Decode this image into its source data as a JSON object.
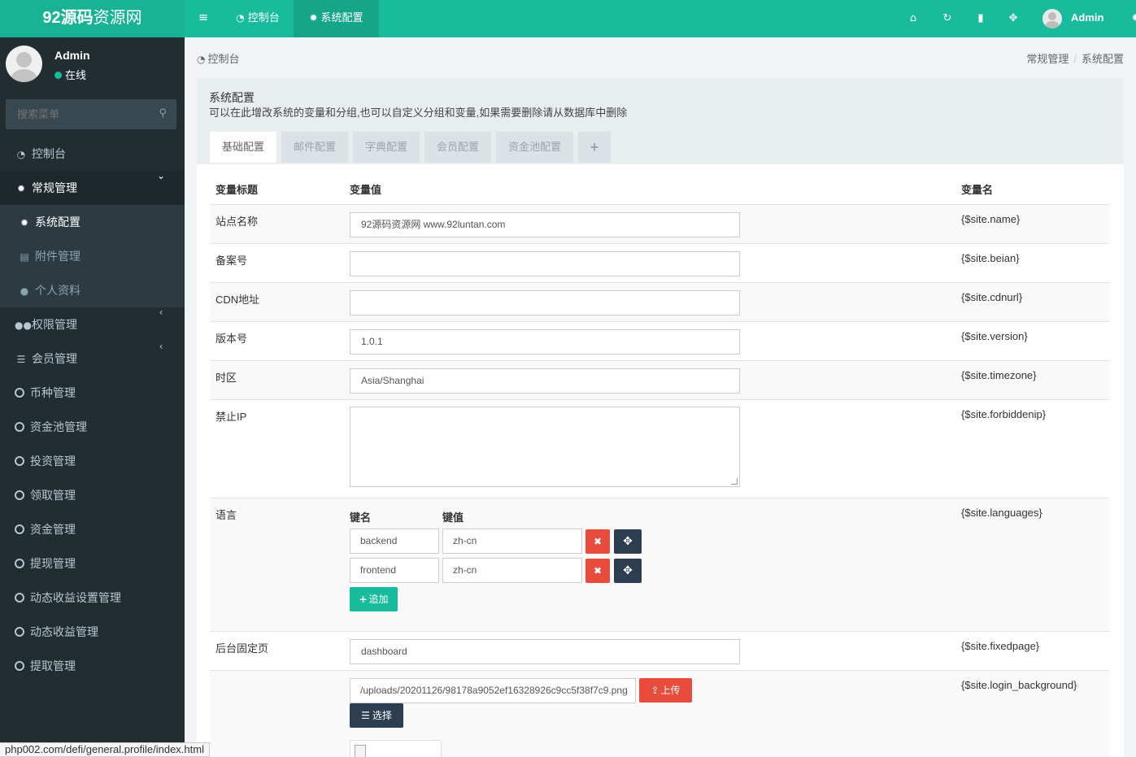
{
  "brand": {
    "bold": "92源码",
    "rest": "资源网"
  },
  "topnav": {
    "tabs": [
      {
        "label": "控制台",
        "icon": "dashboard-icon"
      },
      {
        "label": "系统配置",
        "icon": "gear-icon"
      }
    ],
    "right_icons": [
      "home-icon",
      "refresh-icon",
      "trash-icon",
      "fullscreen-icon"
    ],
    "user": "Admin"
  },
  "sidebar": {
    "user": {
      "name": "Admin",
      "status": "在线"
    },
    "search_placeholder": "搜索菜单",
    "items": [
      {
        "label": "控制台",
        "icon": "dashboard-icon"
      },
      {
        "label": "常规管理",
        "icon": "cogs-icon"
      },
      {
        "label": "系统配置",
        "icon": "gear-icon"
      },
      {
        "label": "附件管理",
        "icon": "file-image-icon"
      },
      {
        "label": "个人资料",
        "icon": "user-icon"
      },
      {
        "label": "权限管理",
        "icon": "group-icon"
      },
      {
        "label": "会员管理",
        "icon": "list-icon"
      },
      {
        "label": "币种管理",
        "icon": "circle-icon"
      },
      {
        "label": "资金池管理",
        "icon": "circle-icon"
      },
      {
        "label": "投资管理",
        "icon": "circle-icon"
      },
      {
        "label": "领取管理",
        "icon": "circle-icon"
      },
      {
        "label": "资金管理",
        "icon": "circle-icon"
      },
      {
        "label": "提现管理",
        "icon": "circle-icon"
      },
      {
        "label": "动态收益设置管理",
        "icon": "circle-icon"
      },
      {
        "label": "动态收益管理",
        "icon": "circle-icon"
      },
      {
        "label": "提取管理",
        "icon": "circle-icon"
      }
    ]
  },
  "breadcrumb": {
    "left": "控制台",
    "right": [
      "常规管理",
      "系统配置"
    ]
  },
  "panel": {
    "title": "系统配置",
    "description": "可以在此增改系统的变量和分组,也可以自定义分组和变量,如果需要删除请从数据库中删除",
    "tabs": [
      "基础配置",
      "邮件配置",
      "字典配置",
      "会员配置",
      "资金池配置",
      "+"
    ]
  },
  "table": {
    "headers": [
      "变量标题",
      "变量值",
      "变量名"
    ],
    "rows": [
      {
        "label": "站点名称",
        "value": "92源码资源网 www.92luntan.com",
        "var": "{$site.name}"
      },
      {
        "label": "备案号",
        "value": "",
        "var": "{$site.beian}"
      },
      {
        "label": "CDN地址",
        "value": "",
        "var": "{$site.cdnurl}"
      },
      {
        "label": "版本号",
        "value": "1.0.1",
        "var": "{$site.version}"
      },
      {
        "label": "时区",
        "value": "Asia/Shanghai",
        "var": "{$site.timezone}"
      },
      {
        "label": "禁止IP",
        "value": "",
        "var": "{$site.forbiddenip}"
      }
    ],
    "languages": {
      "label": "语言",
      "key_header": "键名",
      "value_header": "键值",
      "pairs": [
        {
          "key": "backend",
          "value": "zh-cn"
        },
        {
          "key": "frontend",
          "value": "zh-cn"
        }
      ],
      "add_label": "追加",
      "var": "{$site.languages}"
    },
    "fixedpage": {
      "label": "后台固定页",
      "value": "dashboard",
      "var": "{$site.fixedpage}"
    },
    "login_bg": {
      "value": "/uploads/20201126/98178a9052ef16328926c9cc5f38f7c9.png",
      "upload_label": "上传",
      "choose_label": "选择",
      "var": "{$site.login_background}"
    }
  },
  "statusbar": "php002.com/defi/general.profile/index.html"
}
